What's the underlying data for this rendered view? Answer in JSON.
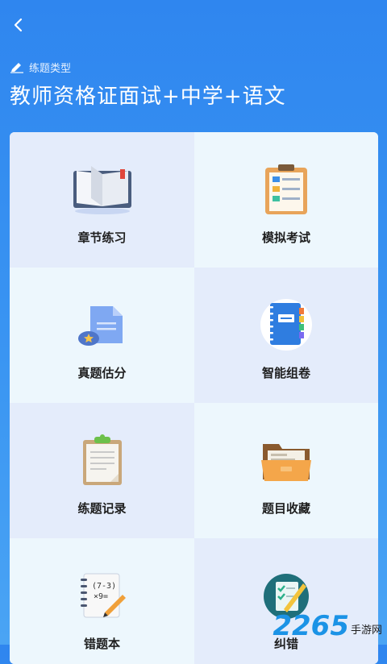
{
  "header": {
    "back_icon": "chevron-left-icon",
    "subtitle_icon": "pencil-icon",
    "subtitle": "练题类型",
    "title": "教师资格证面试+中学+语文"
  },
  "grid": {
    "items": [
      {
        "label": "章节练习",
        "icon": "open-book-icon"
      },
      {
        "label": "模拟考试",
        "icon": "clipboard-list-icon"
      },
      {
        "label": "真题估分",
        "icon": "document-star-icon"
      },
      {
        "label": "智能组卷",
        "icon": "notebook-icon"
      },
      {
        "label": "练题记录",
        "icon": "clipboard-notes-icon"
      },
      {
        "label": "题目收藏",
        "icon": "folder-icon"
      },
      {
        "label": "错题本",
        "icon": "math-notebook-icon"
      },
      {
        "label": "纠错",
        "icon": "checklist-pen-icon"
      }
    ]
  },
  "watermark": {
    "number": "2265",
    "text": "手游网"
  },
  "colors": {
    "header_bg": "#2f86ef",
    "cell_alt": "#e4ecfb",
    "cell_lite": "#edf7fd"
  }
}
